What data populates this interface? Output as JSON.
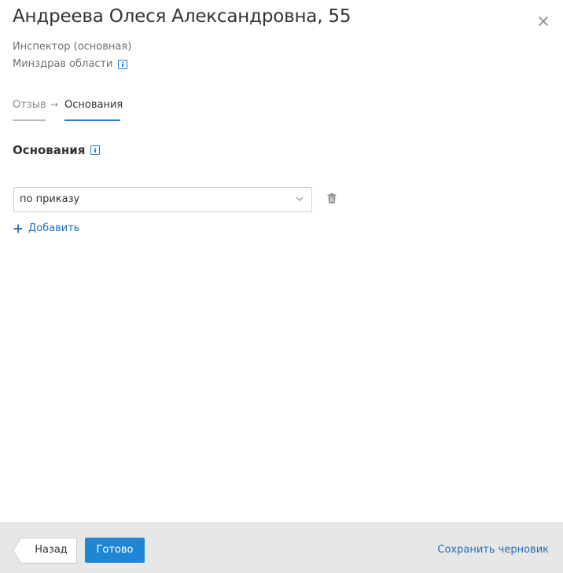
{
  "header": {
    "title": "Андреева Олеся Александровна, 55",
    "role": "Инспектор (основная)",
    "organization": "Минздрав области",
    "close_icon": "close-icon",
    "info_icon": "info-icon"
  },
  "steps": [
    {
      "label": "Отзыв",
      "state": "done"
    },
    {
      "label": "Основания",
      "state": "active"
    }
  ],
  "section": {
    "title": "Основания"
  },
  "grounds": {
    "items": [
      {
        "value": "по приказу"
      }
    ],
    "add_label": "Добавить",
    "delete_icon": "trash-icon"
  },
  "footer": {
    "back_label": "Назад",
    "done_label": "Готово",
    "save_draft_label": "Сохранить черновик"
  },
  "colors": {
    "accent": "#1f86d6",
    "link": "#1f6fb8",
    "footer_bg": "#e7e7e7"
  }
}
